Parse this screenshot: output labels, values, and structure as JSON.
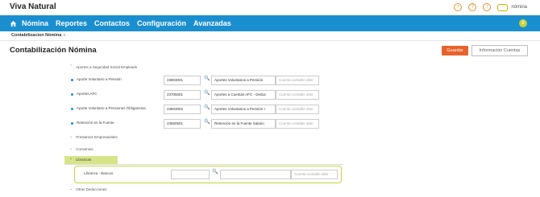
{
  "app": {
    "title": "Viva Natural"
  },
  "topbar": {
    "icons": [
      "plus-icon",
      "question-icon",
      "bell-icon"
    ],
    "icon_glyphs": [
      "+",
      "?",
      "!"
    ],
    "user": "nómina"
  },
  "nav": {
    "items": [
      "Nómina",
      "Reportes",
      "Contactos",
      "Configuración",
      "Avanzadas"
    ],
    "badge": "8"
  },
  "breadcrumb": {
    "tab": "Contabilizacion Nómina",
    "close": "x"
  },
  "page": {
    "title": "Contabilización Nómina"
  },
  "actions": {
    "save": "Guardar",
    "info": "Información Cuentas"
  },
  "sections": {
    "aportes_ss": "Aportes a Seguridad Social Empleado",
    "prestamos": "Prestamos Empresariales",
    "convenios": "Convenios",
    "libranzas": "Libranzas",
    "otras": "Otras Deducciones"
  },
  "rows": [
    {
      "label": "Aporte Voluntario a Pensión",
      "code": "23803001",
      "account": "Aportes Voluntarios a Pensión",
      "alt_placeholder": "Cuenta contable alter"
    },
    {
      "label": "Aportes AFC",
      "code": "23705001",
      "account": "Aportes a Cuentas AFC - Deduc",
      "alt_placeholder": "Cuenta contable alter"
    },
    {
      "label": "Aporte Voluntario a Pensiones Obligatorias",
      "code": "23803002",
      "account": "Aportes Voluntarios a Pensión I",
      "alt_placeholder": "Cuenta contable alter"
    },
    {
      "label": "Retención en la Fuente",
      "code": "23650501",
      "account": "Retención en la Fuente Salario",
      "alt_placeholder": "Cuenta contable alter"
    }
  ],
  "libranza_row": {
    "label": "Libranza - Bancos",
    "code": "",
    "account": "",
    "alt_placeholder": "Cuenta contable alter"
  },
  "colors": {
    "nav_bg": "#1a8fd0",
    "save_bg": "#e8632a",
    "highlight": "#d7e58a"
  }
}
